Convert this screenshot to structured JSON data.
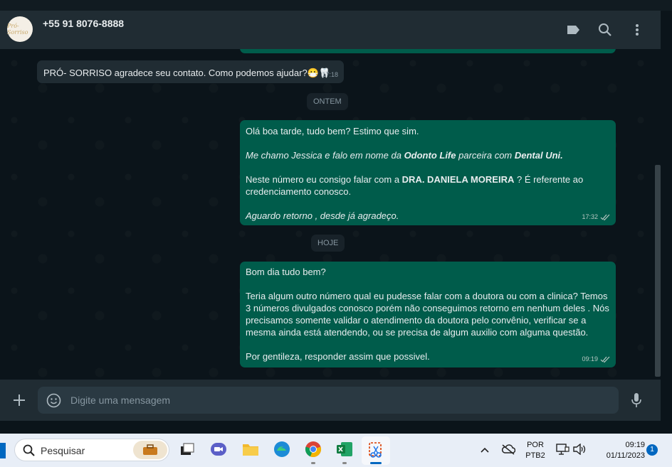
{
  "header": {
    "contact_name": "+55 91 8076-8888",
    "avatar_text": "Pró-Sorriso"
  },
  "messages": {
    "m1": {
      "text": "PRÓ- SORRISO agradece seu contato. Como podemos ajudar?😷🦷",
      "time": "17:18"
    },
    "divider_ontem": "ONTEM",
    "m2": {
      "p1": "Olá boa tarde,  tudo bem? Estimo que sim.",
      "p2a": "Me chamo Jessica e falo em nome da ",
      "p2b": "Odonto Life",
      "p2c": " parceira com ",
      "p2d": "Dental Uni.",
      "p3a": "Neste número eu consigo falar com a ",
      "p3b": "DRA. DANIELA MOREIRA",
      "p3c": " ? É referente ao credenciamento conosco.",
      "p4": "Aguardo retorno , desde já agradeço.",
      "time": "17:32"
    },
    "divider_hoje": "HOJE",
    "m3": {
      "p1": "Bom dia tudo bem?",
      "p2": "Teria algum outro número qual eu pudesse falar com a doutora ou com a clinica? Temos 3 números divulgados conosco porém não conseguimos retorno em nenhum deles . Nós precisamos somente validar o atendimento da doutora pelo convênio, verificar se a mesma ainda está atendendo, ou se precisa de algum auxilio com alguma questão.",
      "p3": "Por gentileza, responder assim que possivel.",
      "time": "09:19"
    }
  },
  "composer": {
    "placeholder": "Digite uma mensagem"
  },
  "taskbar": {
    "search_label": "Pesquisar",
    "lang_line1": "POR",
    "lang_line2": "PTB2",
    "time": "09:19",
    "date": "01/11/2023",
    "notification_count": "1"
  },
  "colors": {
    "outgoing": "#005c4b",
    "incoming": "#202c33",
    "header": "#202c33",
    "background": "#0b141a"
  }
}
